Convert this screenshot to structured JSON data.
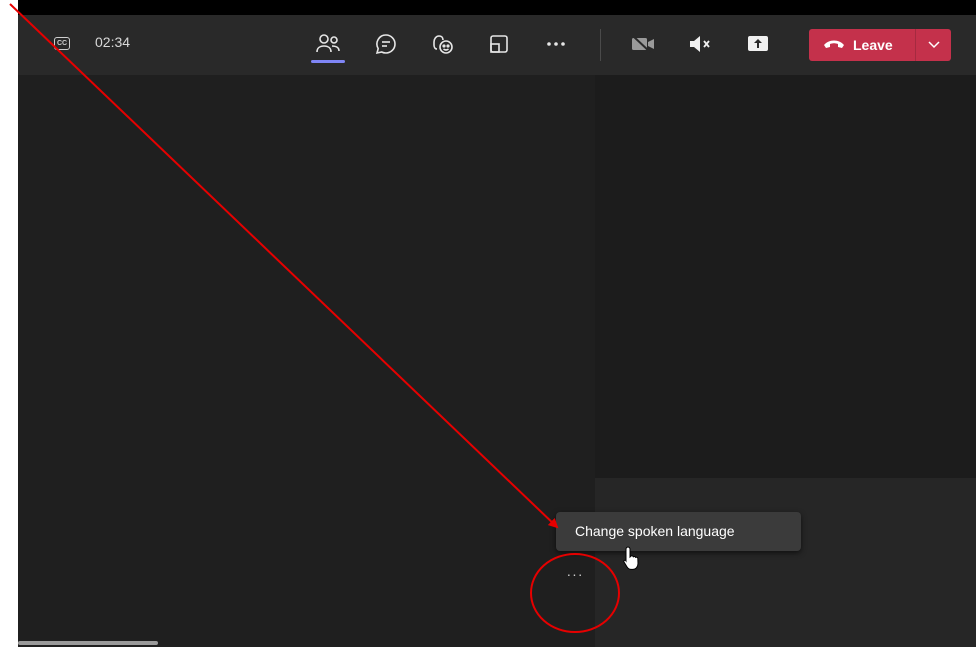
{
  "toolbar": {
    "captions_icon_text": "CC",
    "call_timer": "02:34",
    "leave_label": "Leave"
  },
  "context_menu": {
    "items": [
      {
        "label": "Change spoken language"
      }
    ]
  },
  "more_options_label": "···",
  "colors": {
    "toolbar_bg": "#292929",
    "stage_bg": "#1f1f1f",
    "accent": "#7f85f5",
    "leave_red": "#c4314b",
    "annotation_red": "#e60000"
  },
  "icons": [
    "closed-captions-icon",
    "people-icon",
    "chat-icon",
    "reactions-icon",
    "view-icon",
    "more-horizontal-icon",
    "camera-off-icon",
    "speaker-muted-icon",
    "share-screen-icon",
    "phone-hangup-icon",
    "chevron-down-icon",
    "hand-cursor-icon"
  ]
}
